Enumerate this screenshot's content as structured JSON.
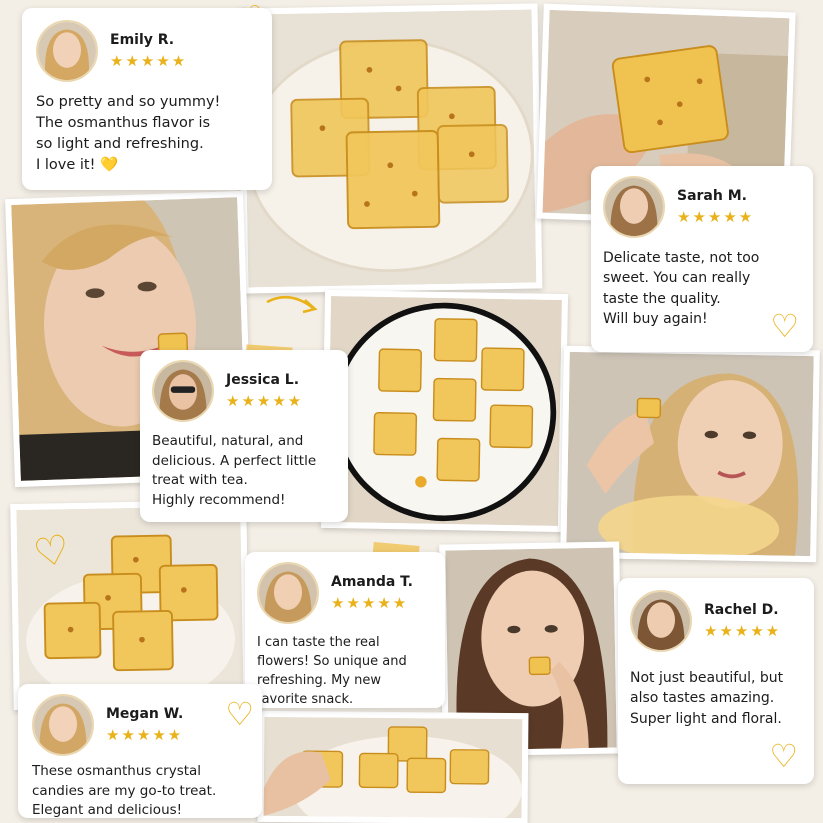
{
  "colors": {
    "accent": "#e9b21b",
    "background": "#f4efe6",
    "card": "#ffffff"
  },
  "reviews": [
    {
      "name": "Emily R.",
      "stars": "★★★★★",
      "text": "So pretty and so yummy!\nThe osmanthus flavor is\nso light and refreshing.\nI love it! 💛"
    },
    {
      "name": "Sarah M.",
      "stars": "★★★★★",
      "text": "Delicate taste, not too\nsweet. You can really\ntaste the quality.\nWill buy again!"
    },
    {
      "name": "Jessica L.",
      "stars": "★★★★★",
      "text": "Beautiful, natural, and\ndelicious. A perfect little\ntreat with tea.\nHighly recommend!"
    },
    {
      "name": "Amanda T.",
      "stars": "★★★★★",
      "text": "I can taste the real\nflowers! So unique and\nrefreshing. My new\nfavorite snack."
    },
    {
      "name": "Rachel D.",
      "stars": "★★★★★",
      "text": "Not just beautiful, but\nalso tastes amazing.\nSuper light and floral."
    },
    {
      "name": "Megan W.",
      "stars": "★★★★★",
      "text": "These osmanthus crystal\ncandies are my go-to treat.\nElegant and delicious!"
    }
  ],
  "decorations": {
    "heart_icon": "heart-outline-icon",
    "heart_glyph": "♡",
    "arrow_icon": "curved-arrow-icon"
  }
}
